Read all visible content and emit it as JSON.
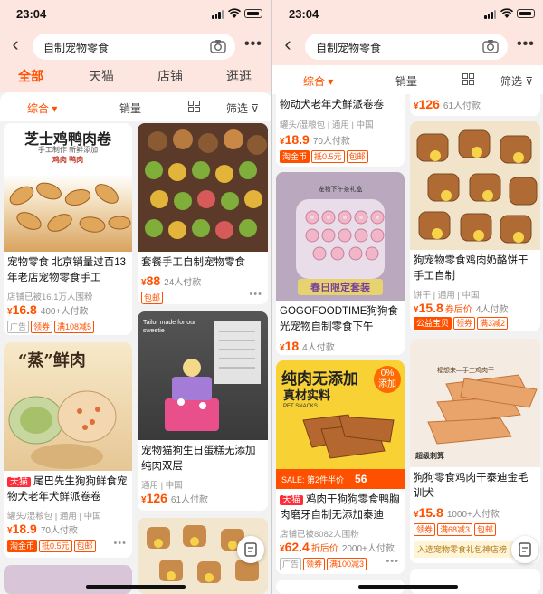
{
  "status": {
    "time": "23:04"
  },
  "search": {
    "query": "自制宠物零食"
  },
  "tabs": [
    "全部",
    "天猫",
    "店铺",
    "逛逛"
  ],
  "filters": {
    "sort": "综合",
    "sales": "销量",
    "filter": "筛选"
  },
  "left": {
    "c1": {
      "banner": "芝士鸡鸭肉卷",
      "banner_sub": "手工制作 新鲜添加",
      "banner_sub2": "鸡肉 鸭肉",
      "title": "宠物零食 北京销量过百13年老店宠物零食手工",
      "meta": "店铺已被16.1万人围粉",
      "price_int": "16.8",
      "sold": "400+人付款",
      "tags": [
        "广告",
        "领券",
        "满108减5"
      ]
    },
    "c2": {
      "title": "套餐手工自制宠物零食",
      "price_int": "88",
      "sold": "24人付款",
      "tags": [
        "包邮"
      ]
    },
    "c3": {
      "banner": "“蒸”鲜肉",
      "title_badge": "天猫",
      "title": "尾巴先生狗狗鲜食宠物犬老年犬鲜派卷卷",
      "meta": "罐头/湿粮包 | 通用 | 中国",
      "price_int": "18.9",
      "sold": "70人付款",
      "tags": [
        "淘金币",
        "抵0.5元",
        "包邮"
      ]
    },
    "c4": {
      "banner": "Tailor made for our sweetie",
      "title": "宠物猫狗生日蛋糕无添加纯肉双层",
      "meta": "通用 | 中国",
      "price_int": "126",
      "sold": "61人付款"
    }
  },
  "right": {
    "c1": {
      "title": "物动犬老年犬鲜派卷卷",
      "meta": "罐头/湿粮包 | 通用 | 中国",
      "price_int": "18.9",
      "sold": "70人付款",
      "tags": [
        "淘金币",
        "抵0.5元",
        "包邮"
      ]
    },
    "c2": {
      "price_int": "126",
      "sold": "61人付款"
    },
    "c3": {
      "banner": "宠物下午茶礼盒",
      "stamp": "春日限定套装",
      "title": "GOGOFOODTIME狗狗食光宠物自制零食下午",
      "price_int": "18",
      "sold": "4人付款"
    },
    "c4": {
      "title": "狗宠物零食鸡肉奶酪饼干手工自制",
      "meta": "饼干 | 通用 | 中国",
      "price_int": "15.8",
      "price_tag": "券后价",
      "sold": "4人付款",
      "tags": [
        "公益宝贝",
        "领券",
        "满3减2"
      ]
    },
    "c5": {
      "banner": "纯肉无添加",
      "banner2": "真材实料",
      "badge": "0%",
      "badge_sub": "添加",
      "pet_snacks": "PET SNACKS",
      "sale": "SALE: 第2件半价",
      "sale_num": "56",
      "title_badge": "天猫",
      "title": "鸡肉干狗狗零食鸭胸肉磨牙自制无添加泰迪",
      "meta": "店铺已被8082人围粉",
      "price_int": "62.4",
      "price_tag": "折后价",
      "sold": "2000+人付款",
      "tags": [
        "广告",
        "领券",
        "满100减3"
      ]
    },
    "c6": {
      "banner": "福想来—手工鸡肉干",
      "stamp": "超级刺算",
      "title": "狗狗零食鸡肉干泰迪金毛训犬",
      "price_int": "15.8",
      "sold": "1000+人付款",
      "tags": [
        "领券",
        "满68减3",
        "包邮"
      ],
      "promo": "入选宠物零食礼包神店榜"
    }
  },
  "colors": {
    "accent": "#ff5000",
    "tmall": "#ff2d37",
    "header_bg": "#fde6e0"
  }
}
